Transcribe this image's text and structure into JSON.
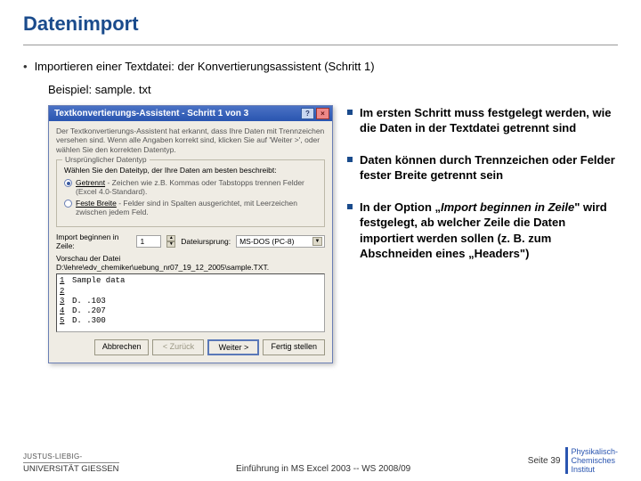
{
  "title": "Datenimport",
  "intro": "Importieren einer Textdatei: der Konvertierungsassistent (Schritt 1)",
  "example": "Beispiel: sample. txt",
  "wizard": {
    "title": "Textkonvertierungs-Assistent - Schritt 1 von 3",
    "desc": "Der Textkonvertierungs-Assistent hat erkannt, dass Ihre Daten mit Trennzeichen versehen sind. Wenn alle Angaben korrekt sind, klicken Sie auf 'Weiter >', oder wählen Sie den korrekten Datentyp.",
    "group_legend": "Ursprünglicher Datentyp",
    "group_lead": "Wählen Sie den Dateityp, der Ihre Daten am besten beschreibt:",
    "radios": [
      {
        "name": "Getrennt",
        "desc": "- Zeichen wie z.B. Kommas oder Tabstopps trennen Felder (Excel 4.0-Standard).",
        "checked": true
      },
      {
        "name": "Feste Breite",
        "desc": "- Felder sind in Spalten ausgerichtet, mit Leerzeichen zwischen jedem Feld.",
        "checked": false
      }
    ],
    "start_row_label": "Import beginnen in Zeile:",
    "start_row_value": "1",
    "origin_label": "Dateiursprung:",
    "origin_value": "MS-DOS (PC-8)",
    "preview_label": "Vorschau der Datei D:\\lehre\\edv_chemiker\\uebung_nr07_19_12_2005\\sample.TXT.",
    "preview_lines": [
      {
        "n": "1",
        "t": "Sample data"
      },
      {
        "n": "2",
        "t": ""
      },
      {
        "n": "3",
        "t": "D. .103"
      },
      {
        "n": "4",
        "t": "D. .207"
      },
      {
        "n": "5",
        "t": "D. .300"
      }
    ],
    "buttons": {
      "cancel": "Abbrechen",
      "back": "< Zurück",
      "next": "Weiter >",
      "finish": "Fertig stellen"
    }
  },
  "notes": [
    "Im ersten Schritt muss festgelegt werden, wie die Daten in der Textdatei getrennt sind",
    "Daten können durch Trennzeichen oder Felder fester Breite getrennt sein",
    "In der Option „Import beginnen in Zeile\" wird festgelegt, ab welcher Zeile die Daten importiert werden sollen (z. B. zum Abschneiden eines „Headers\")"
  ],
  "notes_italic_phrase": "Import beginnen in Zeile",
  "footer": {
    "uni_top": "JUSTUS-LIEBIG-",
    "uni_bottom": "UNIVERSITÄT GIESSEN",
    "center": "Einführung in MS Excel 2003  --  WS 2008/09",
    "page": "Seite 39",
    "inst1": "Physikalisch-",
    "inst2": "Chemisches",
    "inst3": "Institut"
  }
}
